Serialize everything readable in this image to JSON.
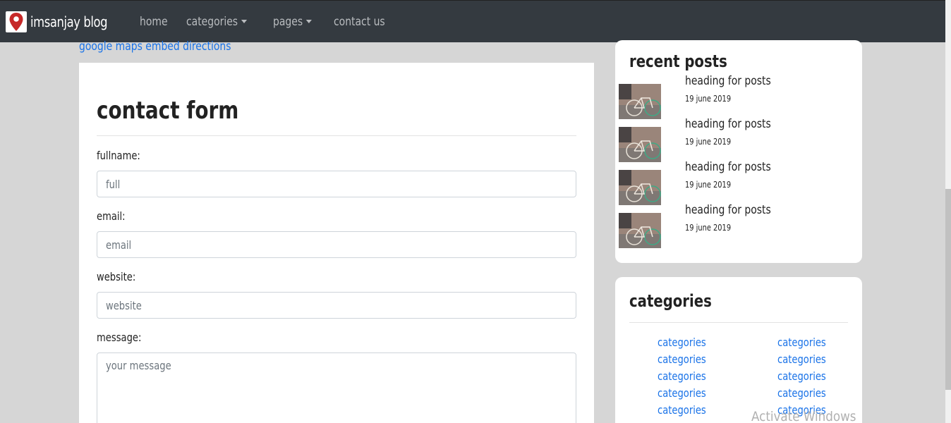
{
  "navbar": {
    "brand": "imsanjay blog",
    "links": {
      "home": "home",
      "categories": "categories",
      "pages": "pages",
      "contact": "contact us"
    }
  },
  "main": {
    "maps_link": "google maps embed directions",
    "contact_form": {
      "title": "contact form",
      "fields": {
        "fullname": {
          "label": "fullname:",
          "placeholder": "full"
        },
        "email": {
          "label": "email:",
          "placeholder": "email"
        },
        "website": {
          "label": "website:",
          "placeholder": "website"
        },
        "message": {
          "label": "message:",
          "placeholder": "your message"
        }
      }
    }
  },
  "sidebar": {
    "recent_posts": {
      "title": "recent posts",
      "posts": [
        {
          "heading": "heading for posts",
          "date": "19 june 2019"
        },
        {
          "heading": "heading for posts",
          "date": "19 june 2019"
        },
        {
          "heading": "heading for posts",
          "date": "19 june 2019"
        },
        {
          "heading": "heading for posts",
          "date": "19 june 2019"
        }
      ]
    },
    "categories": {
      "title": "categories",
      "left": [
        "categories",
        "categories",
        "categories",
        "categories",
        "categories"
      ],
      "right": [
        "categories",
        "categories",
        "categories",
        "categories",
        "categories"
      ]
    }
  },
  "watermark": "Activate Windows",
  "colors": {
    "navbar_bg": "#343a40",
    "page_bg": "#d6d6d6",
    "link": "#1a73e8",
    "logo_pin": "#c62828"
  }
}
